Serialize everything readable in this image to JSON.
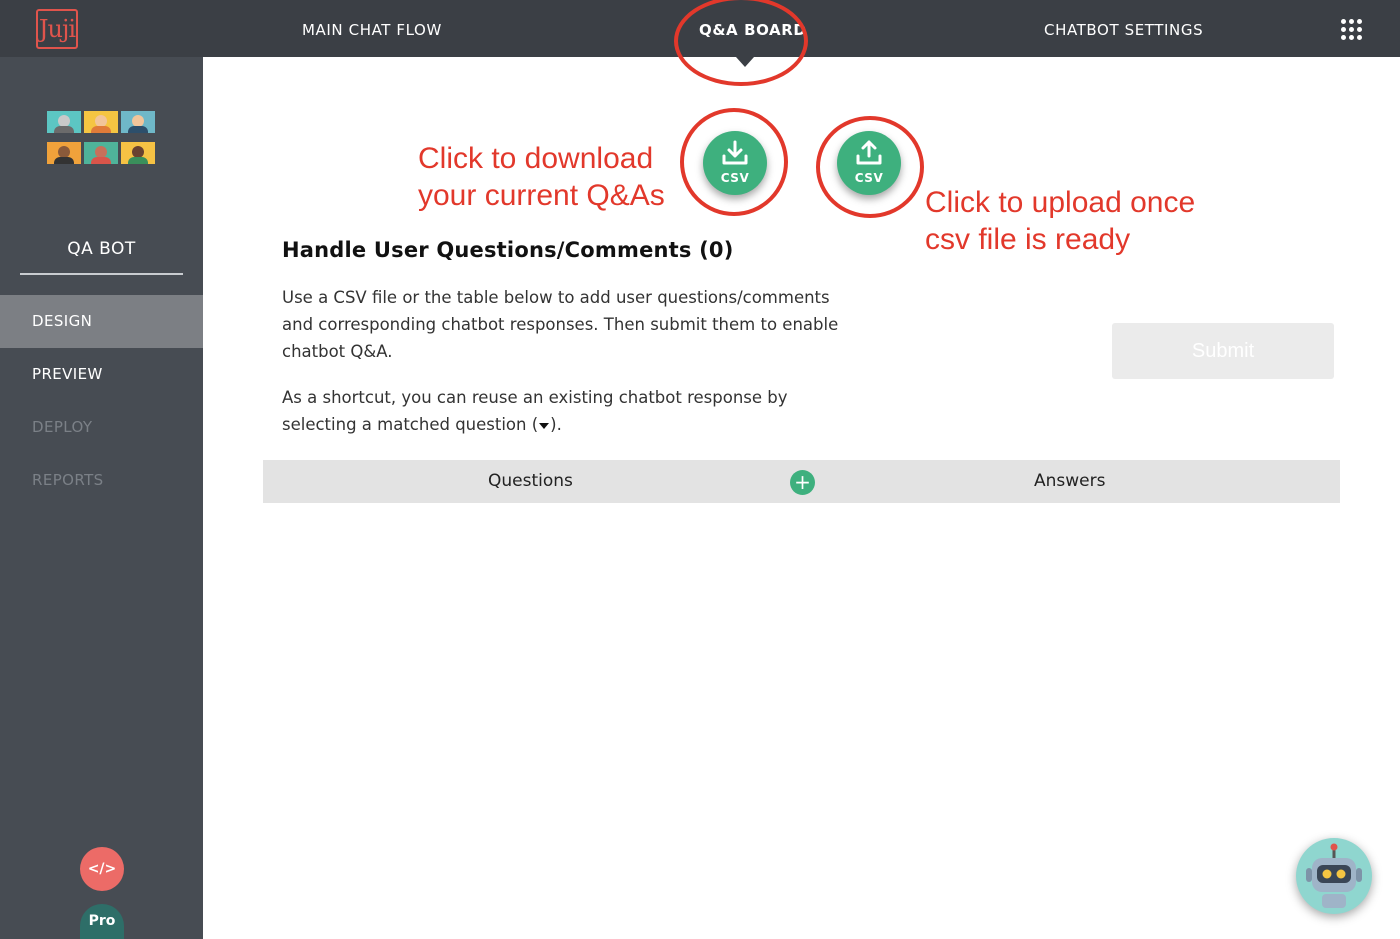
{
  "header": {
    "logo_text": "Juji",
    "tabs": [
      {
        "label": "MAIN CHAT FLOW"
      },
      {
        "label": "Q&A BOARD"
      },
      {
        "label": "CHATBOT SETTINGS"
      }
    ],
    "active_tab": "Q&A BOARD",
    "menu_icon": "grid-icon"
  },
  "sidebar": {
    "bot_name": "QA BOT",
    "items": [
      {
        "label": "DESIGN",
        "state": "active"
      },
      {
        "label": "PREVIEW",
        "state": "enabled"
      },
      {
        "label": "DEPLOY",
        "state": "disabled"
      },
      {
        "label": "REPORTS",
        "state": "disabled"
      }
    ],
    "code_button": "</>",
    "plan_badge": "Pro"
  },
  "main": {
    "download_csv_label": "CSV",
    "upload_csv_label": "CSV",
    "annotation_download": [
      "Click to download",
      "your current Q&As"
    ],
    "annotation_upload": [
      "Click to upload once",
      "csv file is ready"
    ],
    "section_title": "Handle User Questions/Comments (0)",
    "description": [
      "Use a CSV file or the table below to add user questions/comments",
      "and corresponding chatbot responses. Then submit them to enable",
      "chatbot Q&A."
    ],
    "shortcut": [
      "As a shortcut, you can reuse an existing chatbot response by",
      "selecting a matched question (",
      ")."
    ],
    "submit_label": "Submit",
    "table": {
      "columns": [
        "Questions",
        "Answers"
      ],
      "add_label": "+"
    }
  },
  "colors": {
    "topbar": "#3b3f45",
    "sidebar": "#474c53",
    "accent_green": "#3eb07e",
    "annotation_red": "#e2382b",
    "code_button": "#ec6b67"
  }
}
